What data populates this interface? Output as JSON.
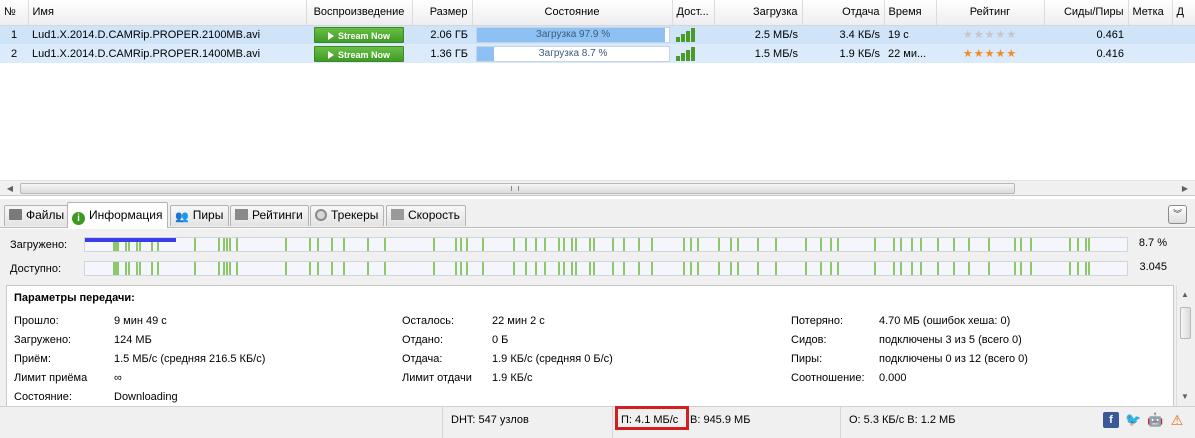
{
  "table": {
    "columns": [
      "№",
      "Имя",
      "Воспроизведение",
      "Размер",
      "Состояние",
      "Дост...",
      "Загрузка",
      "Отдача",
      "Время",
      "Рейтинг",
      "Сиды/Пиры",
      "Метка",
      "Д"
    ],
    "rows": [
      {
        "num": "1",
        "name": "Lud1.X.2014.D.CAMRip.PROPER.2100MB.avi",
        "play": "Stream Now",
        "size": "2.06 ГБ",
        "status": "Загрузка 97.9 %",
        "progress": 97.9,
        "availability_bars": 4,
        "down": "2.5 МБ/s",
        "up": "3.4 КБ/s",
        "time": "19 с",
        "rating_stars": 0,
        "ratio": "0.461"
      },
      {
        "num": "2",
        "name": "Lud1.X.2014.D.CAMRip.PROPER.1400MB.avi",
        "play": "Stream Now",
        "size": "1.36 ГБ",
        "status": "Загрузка 8.7 %",
        "progress": 8.7,
        "availability_bars": 4,
        "down": "1.5 МБ/s",
        "up": "1.9 КБ/s",
        "time": "22 ми...",
        "rating_stars": 5,
        "ratio": "0.416"
      }
    ]
  },
  "tabs": [
    {
      "label": "Файлы",
      "icon": "folder-icon",
      "active": false
    },
    {
      "label": "Информация",
      "icon": "info-icon",
      "active": true
    },
    {
      "label": "Пиры",
      "icon": "peers-icon",
      "active": false
    },
    {
      "label": "Рейтинги",
      "icon": "rating-icon",
      "active": false
    },
    {
      "label": "Трекеры",
      "icon": "tracker-icon",
      "active": false
    },
    {
      "label": "Скорость",
      "icon": "speed-icon",
      "active": false
    }
  ],
  "bars": {
    "downloaded_label": "Загружено:",
    "downloaded_value": "8.7 %",
    "downloaded_fraction": 0.087,
    "available_label": "Доступно:",
    "available_value": "3.045"
  },
  "params": {
    "heading": "Параметры передачи:",
    "col1": [
      {
        "k": "Прошло:",
        "v": "9 мин 49 с"
      },
      {
        "k": "Загружено:",
        "v": "124 МБ"
      },
      {
        "k": "Приём:",
        "v": "1.5 МБ/с (средняя 216.5 КБ/с)"
      },
      {
        "k": "Лимит приёма",
        "v": "∞"
      },
      {
        "k": "Состояние:",
        "v": "Downloading"
      }
    ],
    "col2": [
      {
        "k": "Осталось:",
        "v": "22 мин 2 с"
      },
      {
        "k": "Отдано:",
        "v": "0 Б"
      },
      {
        "k": "Отдача:",
        "v": "1.9 КБ/с (средняя 0 Б/с)"
      },
      {
        "k": "Лимит отдачи",
        "v": "1.9 КБ/с"
      }
    ],
    "col3": [
      {
        "k": "Потеряно:",
        "v": "4.70 МБ (ошибок хеша: 0)"
      },
      {
        "k": "Сидов:",
        "v": "подключены 3 из 5 (всего 0)"
      },
      {
        "k": "Пиры:",
        "v": "подключены 0 из 12 (всего 0)"
      },
      {
        "k": "Соотношение:",
        "v": "0.000"
      }
    ]
  },
  "status": {
    "dht": "DHT: 547 узлов",
    "down": "П: 4.1 МБ/с",
    "down_total": "В: 945.9 МБ",
    "up": "О: 5.3 КБ/с В: 1.2 МБ"
  },
  "colors": {
    "selection": "#cfe3f9",
    "progress_fill": "#8ec1f3",
    "stream_button": "#4ca52f",
    "highlight_box": "#d21f1f",
    "downloaded_bar": "#3c3ce8",
    "available_marks": "#8cc868"
  }
}
